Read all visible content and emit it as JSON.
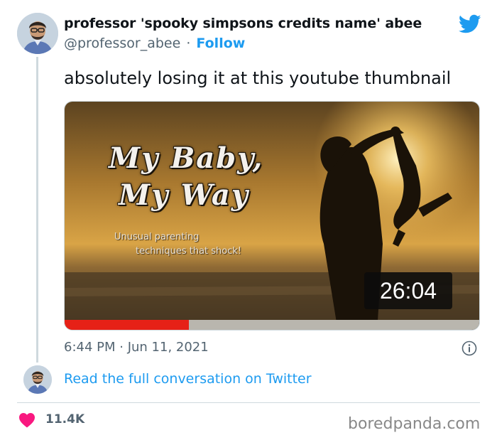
{
  "author": {
    "display_name": "professor 'spooky simpsons credits name' abee",
    "handle": "@professor_abee",
    "separator": "·",
    "follow_label": "Follow"
  },
  "tweet": {
    "text": "absolutely losing it at this youtube thumbnail",
    "timestamp": "6:44 PM · Jun 11, 2021"
  },
  "media": {
    "title_line1": "My Baby,",
    "title_line2": "My Way",
    "subtitle_line1": "Unusual parenting",
    "subtitle_line2": "techniques that shock!",
    "duration": "26:04",
    "watched_fraction": 0.3
  },
  "footer": {
    "read_link": "Read the full conversation on Twitter",
    "like_count": "11.4K"
  },
  "watermark": "boredpanda.com",
  "icons": {
    "platform": "twitter-bird-icon",
    "info": "info-icon",
    "like": "heart-icon"
  },
  "colors": {
    "link": "#1d9bf0",
    "heart": "#f91880",
    "secondary_text": "#536471",
    "progress": "#e62117"
  }
}
